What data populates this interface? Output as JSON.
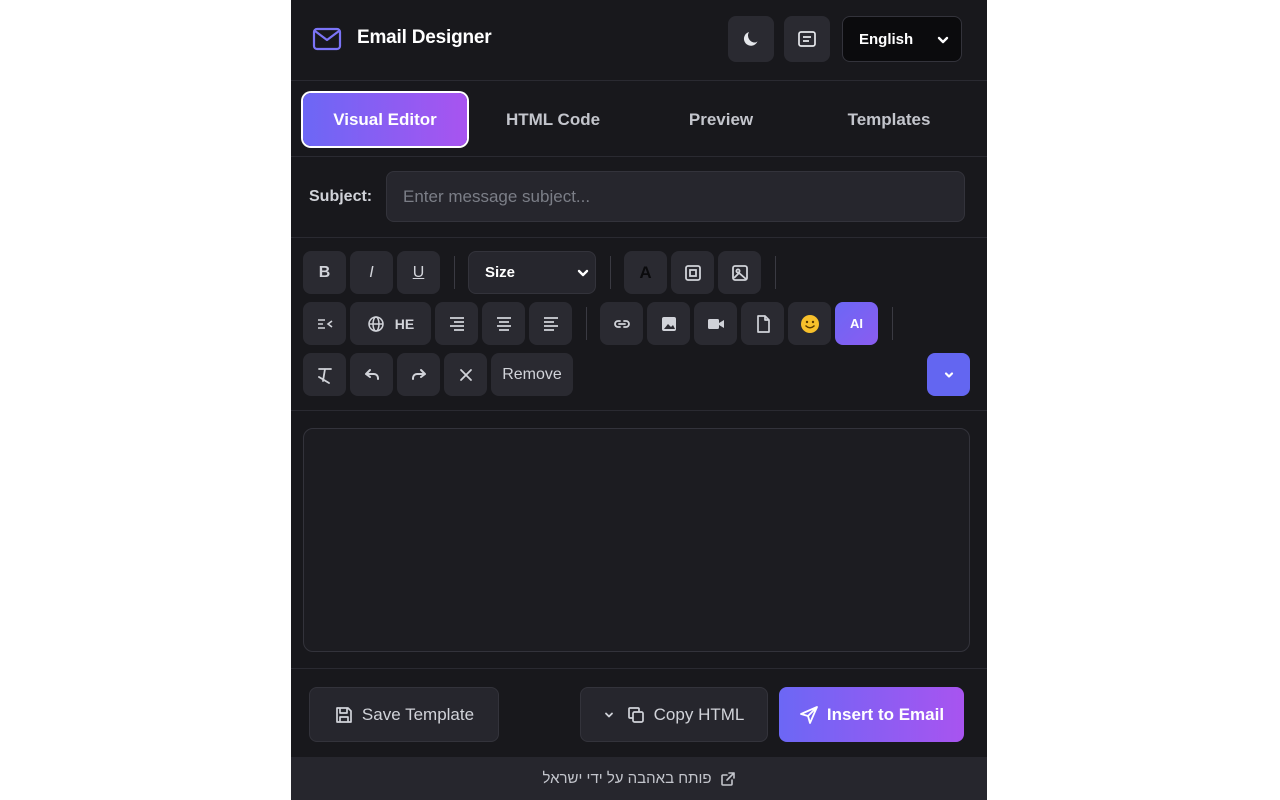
{
  "header": {
    "title": "Email Designer",
    "icons": {
      "logo": "envelope-icon",
      "theme": "moon-icon",
      "panel": "message-box-icon"
    },
    "language": "English"
  },
  "tabs": [
    {
      "label": "Visual Editor",
      "active": true
    },
    {
      "label": "HTML Code",
      "active": false
    },
    {
      "label": "Preview",
      "active": false
    },
    {
      "label": "Templates",
      "active": false
    }
  ],
  "subject": {
    "label": "Subject:",
    "value": "",
    "placeholder": "Enter message subject..."
  },
  "toolbar": {
    "bold": "B",
    "italic": "I",
    "underline": "U",
    "size": "Size",
    "text_color": "A",
    "direction_lang": "HE",
    "ai": "AI",
    "remove": "Remove"
  },
  "footer": {
    "save_template": "Save Template",
    "copy_html": "Copy HTML",
    "insert": "Insert to Email",
    "credit": "פותח באהבה על ידי ישראל"
  },
  "colors": {
    "accent_start": "#6c67f5",
    "accent_end": "#a854f0",
    "panel_bg": "#18181c"
  }
}
